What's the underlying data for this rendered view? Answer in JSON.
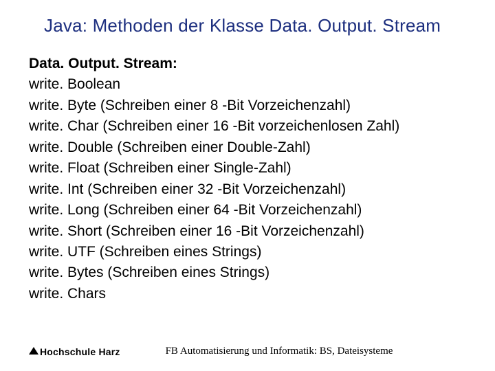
{
  "title": "Java: Methoden der Klasse Data. Output. Stream",
  "heading": "Data. Output. Stream:",
  "lines": [
    "write. Boolean",
    "write. Byte (Schreiben einer 8 -Bit Vorzeichenzahl)",
    "write. Char (Schreiben einer 16 -Bit vorzeichenlosen Zahl)",
    "write. Double (Schreiben einer Double-Zahl)",
    "write. Float (Schreiben einer Single-Zahl)",
    "write. Int (Schreiben einer 32 -Bit Vorzeichenzahl)",
    "write. Long (Schreiben einer 64 -Bit Vorzeichenzahl)",
    "write. Short (Schreiben einer 16 -Bit Vorzeichenzahl)",
    "write. UTF (Schreiben eines Strings)",
    "write. Bytes (Schreiben eines Strings)",
    "write. Chars"
  ],
  "footer": {
    "logo": "Hochschule Harz",
    "text": "FB Automatisierung und Informatik: BS, Dateisysteme"
  }
}
